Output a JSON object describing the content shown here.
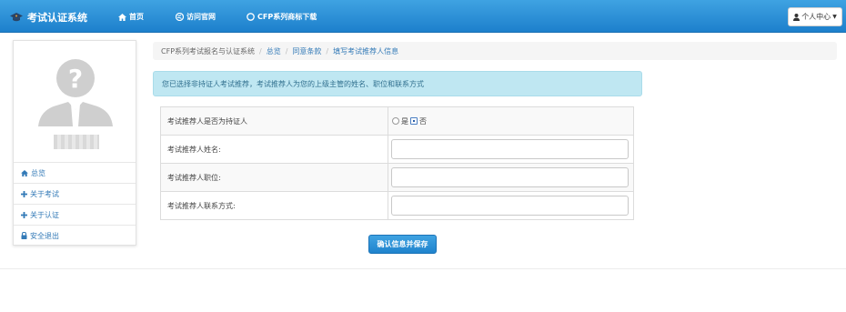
{
  "navbar": {
    "brand": "考试认证系统",
    "links": [
      "首页",
      "访问官网",
      "CFP系列商标下载"
    ],
    "user_menu": "个人中心"
  },
  "sidebar": {
    "menu": [
      "总览",
      "关于考试",
      "关于认证",
      "安全退出"
    ]
  },
  "breadcrumb": {
    "items": [
      "CFP系列考试报名与认证系统",
      "总览",
      "同意条款",
      "填写考试推荐人信息"
    ]
  },
  "alert": {
    "text": "您已选择非持证人考试推荐，考试推荐人为您的上级主管的姓名、职位和联系方式"
  },
  "form": {
    "rows": [
      {
        "label": "考试推荐人是否为持证人",
        "type": "radio",
        "options": [
          "是",
          "否"
        ],
        "selected": "否"
      },
      {
        "label": "考试推荐人姓名:",
        "type": "text",
        "value": ""
      },
      {
        "label": "考试推荐人职位:",
        "type": "text",
        "value": ""
      },
      {
        "label": "考试推荐人联系方式:",
        "type": "text",
        "value": ""
      }
    ],
    "submit_label": "确认信息并保存"
  },
  "colors": {
    "navbar": "#2b8fd8",
    "alert_bg": "#bfe7f2",
    "link": "#337ab7"
  }
}
